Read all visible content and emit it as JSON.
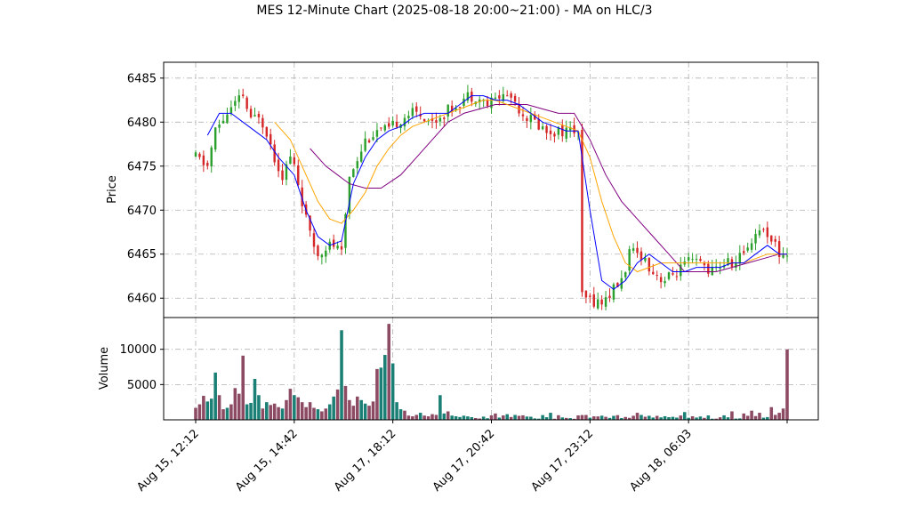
{
  "chart_data": {
    "type": "candlestick",
    "title": "MES 12-Minute Chart (2025-08-18 20:00~21:00) - MA on HLC/3",
    "price_panel": {
      "ylabel": "Price",
      "yticks": [
        6460,
        6465,
        6470,
        6475,
        6480,
        6485
      ],
      "ylim": [
        6457.8,
        6486.8
      ]
    },
    "volume_panel": {
      "ylabel": "Volume",
      "yticks": [
        5000,
        10000
      ],
      "ylim": [
        0,
        14500
      ]
    },
    "x_tick_labels": [
      "Aug 15, 12:12",
      "Aug 15, 14:42",
      "Aug 17, 18:12",
      "Aug 17, 20:42",
      "Aug 17, 23:12",
      "Aug 18, 06:03"
    ],
    "x_tick_index": [
      0,
      25,
      50,
      75,
      100,
      125
    ],
    "n_bars": 151,
    "grid": true,
    "colors": {
      "up": "#2ca02c",
      "down": "#d62728",
      "volume_up": "#1a7f74",
      "volume_down": "#8c4a63",
      "ma_fast": "#0000ff",
      "ma_mid": "#ffa500",
      "ma_slow": "#800080"
    },
    "price_anchors": [
      [
        0,
        6476
      ],
      [
        3,
        6475
      ],
      [
        5,
        6479
      ],
      [
        8,
        6481
      ],
      [
        10,
        6482
      ],
      [
        12,
        6483
      ],
      [
        14,
        6480
      ],
      [
        16,
        6481
      ],
      [
        18,
        6479
      ],
      [
        20,
        6476
      ],
      [
        22,
        6474
      ],
      [
        24,
        6476
      ],
      [
        25,
        6475
      ],
      [
        27,
        6471
      ],
      [
        29,
        6467
      ],
      [
        31,
        6465
      ],
      [
        33,
        6466
      ],
      [
        35,
        6466
      ],
      [
        37,
        6465
      ],
      [
        39,
        6474
      ],
      [
        41,
        6476
      ],
      [
        43,
        6478
      ],
      [
        46,
        6479
      ],
      [
        49,
        6479
      ],
      [
        51,
        6480
      ],
      [
        54,
        6481
      ],
      [
        57,
        6481
      ],
      [
        60,
        6480
      ],
      [
        63,
        6481
      ],
      [
        66,
        6482
      ],
      [
        69,
        6483
      ],
      [
        71,
        6483
      ],
      [
        74,
        6482
      ],
      [
        77,
        6483
      ],
      [
        80,
        6483
      ],
      [
        83,
        6481
      ],
      [
        86,
        6480
      ],
      [
        89,
        6479
      ],
      [
        92,
        6479
      ],
      [
        95,
        6479
      ],
      [
        97,
        6479
      ],
      [
        98,
        6460
      ],
      [
        103,
        6459.5
      ],
      [
        106,
        6461
      ],
      [
        108,
        6462
      ],
      [
        110,
        6465
      ],
      [
        113,
        6465
      ],
      [
        116,
        6463
      ],
      [
        119,
        6462
      ],
      [
        122,
        6463
      ],
      [
        125,
        6464
      ],
      [
        128,
        6464
      ],
      [
        131,
        6463
      ],
      [
        134,
        6464
      ],
      [
        137,
        6464
      ],
      [
        140,
        6466
      ],
      [
        143,
        6468
      ],
      [
        146,
        6467
      ],
      [
        148,
        6465
      ],
      [
        150,
        6465
      ]
    ],
    "volume_spikes": [
      [
        0,
        1700
      ],
      [
        1,
        2200
      ],
      [
        2,
        3400
      ],
      [
        3,
        2600
      ],
      [
        4,
        3000
      ],
      [
        5,
        6700
      ],
      [
        6,
        3500
      ],
      [
        7,
        1500
      ],
      [
        8,
        1700
      ],
      [
        9,
        2200
      ],
      [
        10,
        4500
      ],
      [
        11,
        3700
      ],
      [
        12,
        9100
      ],
      [
        13,
        2200
      ],
      [
        14,
        2400
      ],
      [
        15,
        5800
      ],
      [
        16,
        3500
      ],
      [
        17,
        1600
      ],
      [
        18,
        2500
      ],
      [
        19,
        2100
      ],
      [
        20,
        2300
      ],
      [
        21,
        1800
      ],
      [
        22,
        1600
      ],
      [
        23,
        2800
      ],
      [
        24,
        4400
      ],
      [
        25,
        3500
      ],
      [
        26,
        3200
      ],
      [
        27,
        2500
      ],
      [
        28,
        1800
      ],
      [
        29,
        2500
      ],
      [
        30,
        1700
      ],
      [
        31,
        1500
      ],
      [
        32,
        1200
      ],
      [
        33,
        1600
      ],
      [
        34,
        2200
      ],
      [
        35,
        3300
      ],
      [
        36,
        4300
      ],
      [
        37,
        12700
      ],
      [
        38,
        4800
      ],
      [
        39,
        2800
      ],
      [
        40,
        2000
      ],
      [
        41,
        3300
      ],
      [
        42,
        2800
      ],
      [
        43,
        2300
      ],
      [
        44,
        2000
      ],
      [
        45,
        2600
      ],
      [
        46,
        7200
      ],
      [
        47,
        7400
      ],
      [
        48,
        9200
      ],
      [
        49,
        13600
      ],
      [
        50,
        8000
      ],
      [
        51,
        2500
      ],
      [
        52,
        1500
      ],
      [
        53,
        1300
      ],
      [
        54,
        600
      ],
      [
        55,
        500
      ],
      [
        56,
        700
      ],
      [
        57,
        1000
      ],
      [
        58,
        600
      ],
      [
        59,
        500
      ],
      [
        60,
        800
      ],
      [
        61,
        700
      ],
      [
        62,
        3500
      ],
      [
        63,
        900
      ],
      [
        64,
        1200
      ],
      [
        65,
        600
      ],
      [
        66,
        500
      ],
      [
        67,
        400
      ],
      [
        76,
        900
      ],
      [
        79,
        800
      ],
      [
        90,
        1000
      ],
      [
        112,
        1000
      ],
      [
        124,
        1100
      ],
      [
        136,
        1200
      ],
      [
        139,
        900
      ],
      [
        141,
        1300
      ],
      [
        143,
        1000
      ],
      [
        146,
        1800
      ],
      [
        147,
        700
      ],
      [
        148,
        1000
      ],
      [
        149,
        1600
      ],
      [
        150,
        10000
      ]
    ],
    "ma_fast": [
      [
        3,
        6478.5
      ],
      [
        6,
        6481
      ],
      [
        9,
        6481
      ],
      [
        12,
        6480
      ],
      [
        15,
        6479
      ],
      [
        18,
        6478
      ],
      [
        21,
        6476
      ],
      [
        25,
        6474
      ],
      [
        28,
        6470
      ],
      [
        31,
        6467
      ],
      [
        34,
        6466
      ],
      [
        37,
        6466.5
      ],
      [
        40,
        6473
      ],
      [
        43,
        6476
      ],
      [
        46,
        6478
      ],
      [
        49,
        6479
      ],
      [
        52,
        6479.5
      ],
      [
        55,
        6480.5
      ],
      [
        58,
        6481
      ],
      [
        61,
        6481
      ],
      [
        64,
        6481
      ],
      [
        67,
        6482
      ],
      [
        70,
        6483
      ],
      [
        73,
        6483
      ],
      [
        76,
        6482.5
      ],
      [
        79,
        6482.5
      ],
      [
        82,
        6482
      ],
      [
        85,
        6481
      ],
      [
        88,
        6480
      ],
      [
        91,
        6479.5
      ],
      [
        94,
        6479
      ],
      [
        97,
        6479
      ],
      [
        100,
        6470
      ],
      [
        103,
        6462
      ],
      [
        106,
        6461
      ],
      [
        109,
        6462
      ],
      [
        112,
        6464
      ],
      [
        115,
        6465
      ],
      [
        118,
        6464
      ],
      [
        121,
        6463
      ],
      [
        124,
        6463
      ],
      [
        127,
        6463.5
      ],
      [
        130,
        6463.5
      ],
      [
        133,
        6463.5
      ],
      [
        136,
        6464
      ],
      [
        139,
        6464
      ],
      [
        142,
        6465
      ],
      [
        145,
        6466
      ],
      [
        148,
        6465
      ],
      [
        150,
        6465
      ]
    ],
    "ma_mid": [
      [
        20,
        6480
      ],
      [
        24,
        6478
      ],
      [
        28,
        6474
      ],
      [
        31,
        6471
      ],
      [
        34,
        6469
      ],
      [
        37,
        6468.5
      ],
      [
        40,
        6470
      ],
      [
        43,
        6472
      ],
      [
        46,
        6475
      ],
      [
        49,
        6477
      ],
      [
        52,
        6478.5
      ],
      [
        55,
        6479.5
      ],
      [
        58,
        6480
      ],
      [
        61,
        6480.5
      ],
      [
        64,
        6481
      ],
      [
        67,
        6481.5
      ],
      [
        70,
        6482
      ],
      [
        73,
        6482.5
      ],
      [
        76,
        6482.5
      ],
      [
        79,
        6482
      ],
      [
        82,
        6481.5
      ],
      [
        85,
        6481
      ],
      [
        88,
        6480.5
      ],
      [
        91,
        6480
      ],
      [
        94,
        6479.5
      ],
      [
        97,
        6479
      ],
      [
        100,
        6476
      ],
      [
        103,
        6471
      ],
      [
        106,
        6467
      ],
      [
        109,
        6464
      ],
      [
        112,
        6463
      ],
      [
        115,
        6463.5
      ],
      [
        118,
        6464
      ],
      [
        121,
        6464
      ],
      [
        124,
        6464
      ],
      [
        127,
        6464
      ],
      [
        130,
        6464
      ],
      [
        133,
        6464
      ],
      [
        136,
        6464
      ],
      [
        139,
        6464
      ],
      [
        142,
        6464.5
      ],
      [
        145,
        6465
      ],
      [
        148,
        6465
      ],
      [
        150,
        6465
      ]
    ],
    "ma_slow": [
      [
        29,
        6477
      ],
      [
        33,
        6475
      ],
      [
        36,
        6474
      ],
      [
        39,
        6473
      ],
      [
        43,
        6472.5
      ],
      [
        47,
        6472.5
      ],
      [
        52,
        6474
      ],
      [
        56,
        6476
      ],
      [
        60,
        6478
      ],
      [
        64,
        6480
      ],
      [
        68,
        6481
      ],
      [
        72,
        6481.5
      ],
      [
        76,
        6482
      ],
      [
        80,
        6482
      ],
      [
        84,
        6482
      ],
      [
        88,
        6481.5
      ],
      [
        92,
        6481
      ],
      [
        96,
        6481
      ],
      [
        100,
        6478
      ],
      [
        104,
        6474
      ],
      [
        108,
        6471
      ],
      [
        112,
        6469
      ],
      [
        116,
        6467
      ],
      [
        120,
        6465
      ],
      [
        124,
        6463
      ],
      [
        128,
        6463
      ],
      [
        132,
        6463
      ],
      [
        136,
        6463.5
      ],
      [
        140,
        6464
      ],
      [
        144,
        6464.5
      ],
      [
        148,
        6465
      ],
      [
        150,
        6465
      ]
    ]
  }
}
